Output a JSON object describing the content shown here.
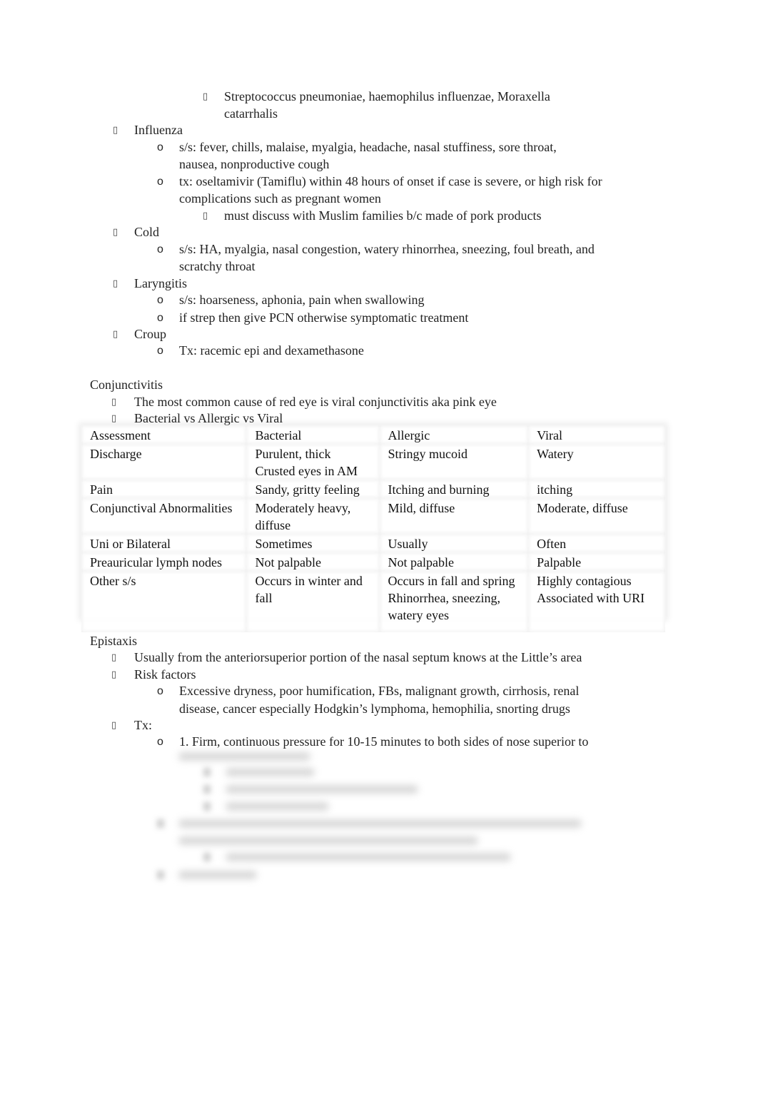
{
  "bullets": {
    "box": "▯",
    "square": "▯",
    "circle": "o"
  },
  "upper": {
    "strep_item": [
      "Streptococcus pneumoniae, haemophilus influenzae, Moraxella",
      "catarrhalis"
    ],
    "influenza": {
      "title": "Influenza",
      "ss": [
        "s/s: fever, chills, malaise, myalgia, headache, nasal stuffiness, sore throat,",
        "nausea, nonproductive cough"
      ],
      "tx": [
        "tx: oseltamivir (Tamiflu) within 48 hours of onset if case is severe, or high risk for",
        "complications such as pregnant women"
      ],
      "tx_note": "must discuss with Muslim families b/c made of pork products"
    },
    "cold": {
      "title": "Cold",
      "ss": [
        "s/s: HA, myalgia, nasal congestion, watery rhinorrhea, sneezing, foul breath, and",
        "scratchy throat"
      ]
    },
    "laryngitis": {
      "title": "Laryngitis",
      "ss": "s/s: hoarseness, aphonia, pain when swallowing",
      "tx": "if strep then give PCN otherwise symptomatic treatment"
    },
    "croup": {
      "title": "Croup",
      "tx": "Tx: racemic epi and dexamethasone"
    }
  },
  "conjunctivitis": {
    "heading": "Conjunctivitis",
    "bullets": [
      "The most common cause of red eye is viral conjunctivitis aka pink eye",
      "Bacterial vs Allergic vs Viral"
    ],
    "table": {
      "header": [
        "Assessment",
        "Bacterial",
        "Allergic",
        "Viral"
      ],
      "rows": [
        [
          "Discharge",
          [
            "Purulent, thick",
            "Crusted eyes in AM"
          ],
          [
            "Stringy mucoid"
          ],
          [
            "Watery"
          ]
        ],
        [
          "Pain",
          [
            "Sandy, gritty feeling"
          ],
          [
            "Itching and burning"
          ],
          [
            "itching"
          ]
        ],
        [
          "Conjunctival Abnormalities",
          [
            "Moderately heavy,",
            "diffuse"
          ],
          [
            "Mild, diffuse"
          ],
          [
            "Moderate, diffuse"
          ]
        ],
        [
          "Uni or Bilateral",
          [
            "Sometimes"
          ],
          [
            "Usually"
          ],
          [
            "Often"
          ]
        ],
        [
          "Preauricular lymph nodes",
          [
            "Not palpable"
          ],
          [
            "Not palpable"
          ],
          [
            "Palpable"
          ]
        ],
        [
          "Other s/s",
          [
            "Occurs in winter and",
            "fall"
          ],
          [
            "Occurs in fall and spring",
            "Rhinorrhea, sneezing,",
            "watery eyes"
          ],
          [
            "Highly contagious",
            "Associated with URI"
          ]
        ]
      ]
    }
  },
  "epistaxis": {
    "heading": "Epistaxis",
    "location": "Usually from the anteriorsuperior portion of the nasal septum knows at the Little’s area",
    "risk_title": "Risk factors",
    "risk": [
      "Excessive dryness, poor humification, FBs, malignant growth, cirrhosis, renal",
      "disease, cancer especially Hodgkin’s lymphoma, hemophilia, snorting drugs"
    ],
    "tx_title": "Tx:",
    "tx_first": "1. Firm, continuous pressure for 10-15 minutes to both sides of nose superior to"
  }
}
